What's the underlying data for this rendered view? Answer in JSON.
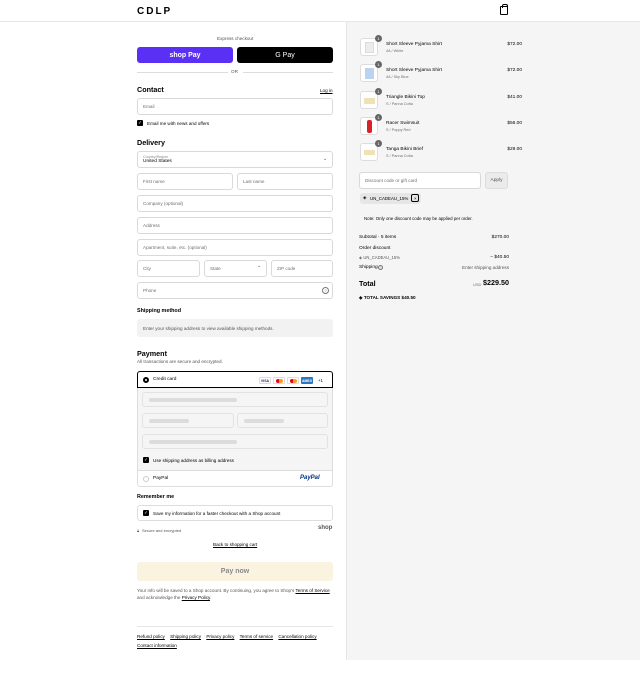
{
  "header": {
    "logo": "CDLP",
    "bag_icon": "bag-icon"
  },
  "express": {
    "title": "Express checkout",
    "shop_pay": "shop Pay",
    "google_pay": "G Pay",
    "or": "OR"
  },
  "contact": {
    "title": "Contact",
    "login": "Log in",
    "email_placeholder": "Email",
    "news_label": "Email me with news and offers"
  },
  "delivery": {
    "title": "Delivery",
    "country_label": "Country/Region",
    "country_value": "United States",
    "first_name": "First name",
    "last_name": "Last name",
    "company": "Company (optional)",
    "address": "Address",
    "apartment": "Apartment, suite, etc. (optional)",
    "city": "City",
    "state": "State",
    "zip": "ZIP code",
    "phone": "Phone"
  },
  "shipping": {
    "title": "Shipping method",
    "note": "Enter your shipping address to view available shipping methods."
  },
  "payment": {
    "title": "Payment",
    "subtitle": "All transactions are secure and encrypted.",
    "credit_card": "Credit card",
    "cards": [
      "VISA",
      "MC",
      "MC",
      "AMEX"
    ],
    "more": "+1",
    "billing_label": "Use shipping address as billing address",
    "paypal": "PayPal",
    "paypal_logo": "PayPal"
  },
  "remember": {
    "title": "Remember me",
    "save_label": "Save my information for a faster checkout with a Shop account",
    "secure": "Secure and encrypted",
    "shop_logo": "shop"
  },
  "back_link": "Back to shopping cart",
  "pay_now": "Pay now",
  "legal": {
    "text1": "Your info will be saved to a Shop account. By continuing, you agree to Shop's",
    "terms": "Terms of Service",
    "text2": "and acknowledge the",
    "privacy": "Privacy Policy",
    "period": "."
  },
  "footer_links": [
    "Refund policy",
    "Shipping policy",
    "Privacy policy",
    "Terms of service",
    "Cancellation policy",
    "Contact information"
  ],
  "cart": {
    "items": [
      {
        "name": "Short Sleeve Pyjama Shirt",
        "variant": "4A / White",
        "price": "$72.00",
        "qty": "1",
        "color": "#f2f2f2"
      },
      {
        "name": "Short Sleeve Pyjama Shirt",
        "variant": "4A / Sky Blue",
        "price": "$72.00",
        "qty": "1",
        "color": "#bcd3f0"
      },
      {
        "name": "Triangle Bikini Top",
        "variant": "S / Panna Cotta",
        "price": "$41.00",
        "qty": "1",
        "color": "#efe2b4"
      },
      {
        "name": "Racer Swimsuit",
        "variant": "S / Poppy Red",
        "price": "$56.00",
        "qty": "1",
        "color": "#d8232a"
      },
      {
        "name": "Tanga Bikini Brief",
        "variant": "S / Panna Cotta",
        "price": "$29.00",
        "qty": "1",
        "color": "#efe2b4"
      }
    ],
    "discount_placeholder": "Discount code or gift card",
    "apply": "Apply",
    "code_tag": "UN_CADEAU_15%",
    "note": "Note: Only one discount code may be applied per order.",
    "subtotal_label": "Subtotal · 5 items",
    "subtotal_value": "$270.00",
    "order_discount_label": "Order discount",
    "discount_code": "UN_CADEAU_15%",
    "discount_value": "– $40.50",
    "shipping_label": "Shipping",
    "shipping_value": "Enter shipping address",
    "total_label": "Total",
    "currency": "USD",
    "total_value": "$229.50",
    "savings_label": "TOTAL SAVINGS",
    "savings_value": "$40.50"
  },
  "colors": {
    "shop_pay": "#5a31f4",
    "background_right": "#f5f5f5",
    "pay_now_bg": "#faf3df"
  }
}
